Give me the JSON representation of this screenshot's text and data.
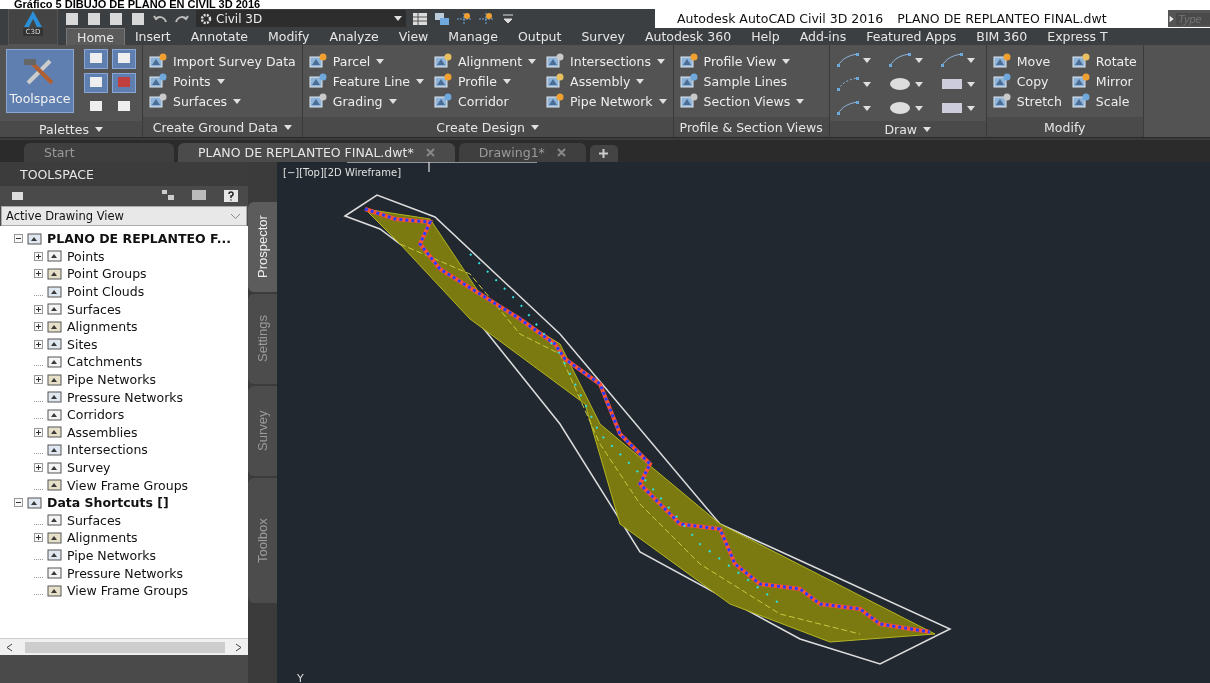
{
  "caption": "Gráfico 5 DIBUJO DE PLANO EN CIVIL 3D 2016",
  "title_bar": {
    "app_badge": "C3D",
    "workspace": "Civil 3D",
    "title": "Autodesk AutoCAD Civil 3D 2016",
    "document": "PLANO DE REPLANTEO FINAL.dwt",
    "search": {
      "placeholder": "Type"
    }
  },
  "ribbon_tabs": [
    {
      "label": "Home",
      "selected": true
    },
    {
      "label": "Insert",
      "selected": false
    },
    {
      "label": "Annotate",
      "selected": false
    },
    {
      "label": "Modify",
      "selected": false
    },
    {
      "label": "Analyze",
      "selected": false
    },
    {
      "label": "View",
      "selected": false
    },
    {
      "label": "Manage",
      "selected": false
    },
    {
      "label": "Output",
      "selected": false
    },
    {
      "label": "Survey",
      "selected": false
    },
    {
      "label": "Autodesk 360",
      "selected": false
    },
    {
      "label": "Help",
      "selected": false
    },
    {
      "label": "Add-ins",
      "selected": false
    },
    {
      "label": "Featured Apps",
      "selected": false
    },
    {
      "label": "BIM 360",
      "selected": false
    },
    {
      "label": "Express T",
      "selected": false
    }
  ],
  "ribbon_panels": [
    {
      "kind": "palettes",
      "title": "Palettes",
      "dropdown": true,
      "big_button": "Toolspace"
    },
    {
      "kind": "tools",
      "title": "Create Ground Data",
      "dropdown": true,
      "columns": [
        [
          {
            "label": "Import Survey Data",
            "dropdown": false
          },
          {
            "label": "Points",
            "dropdown": true
          },
          {
            "label": "Surfaces",
            "dropdown": true
          }
        ]
      ]
    },
    {
      "kind": "tools",
      "title": "Create Design",
      "dropdown": true,
      "columns": [
        [
          {
            "label": "Parcel",
            "dropdown": true
          },
          {
            "label": "Feature Line",
            "dropdown": true
          },
          {
            "label": "Grading",
            "dropdown": true
          }
        ],
        [
          {
            "label": "Alignment",
            "dropdown": true
          },
          {
            "label": "Profile",
            "dropdown": true
          },
          {
            "label": "Corridor",
            "dropdown": false
          }
        ],
        [
          {
            "label": "Intersections",
            "dropdown": true
          },
          {
            "label": "Assembly",
            "dropdown": true
          },
          {
            "label": "Pipe Network",
            "dropdown": true
          }
        ]
      ]
    },
    {
      "kind": "tools",
      "title": "Profile & Section Views",
      "dropdown": false,
      "columns": [
        [
          {
            "label": "Profile View",
            "dropdown": true
          },
          {
            "label": "Sample Lines",
            "dropdown": false
          },
          {
            "label": "Section Views",
            "dropdown": true
          }
        ]
      ]
    },
    {
      "kind": "draw",
      "title": "Draw",
      "dropdown": true
    },
    {
      "kind": "tools",
      "title": "Modify",
      "dropdown": false,
      "columns": [
        [
          {
            "label": "Move",
            "dropdown": false
          },
          {
            "label": "Copy",
            "dropdown": false
          },
          {
            "label": "Stretch",
            "dropdown": false
          }
        ],
        [
          {
            "label": "Rotate",
            "dropdown": false
          },
          {
            "label": "Mirror",
            "dropdown": false
          },
          {
            "label": "Scale",
            "dropdown": false
          }
        ]
      ]
    }
  ],
  "document_tabs": [
    {
      "label": "Start",
      "selected": false,
      "closable": false
    },
    {
      "label": "PLANO DE REPLANTEO FINAL.dwt*",
      "selected": true,
      "closable": true
    },
    {
      "label": "Drawing1*",
      "selected": false,
      "closable": true
    }
  ],
  "toolspace": {
    "title": "TOOLSPACE",
    "view": "Active Drawing View",
    "tree": [
      {
        "label": "PLANO DE REPLANTEO F...",
        "expandable": true,
        "expanded": true,
        "children": [
          {
            "label": "Points",
            "expandable": true,
            "expanded": false
          },
          {
            "label": "Point Groups",
            "expandable": true,
            "expanded": false
          },
          {
            "label": "Point Clouds",
            "expandable": false
          },
          {
            "label": "Surfaces",
            "expandable": true,
            "expanded": false
          },
          {
            "label": "Alignments",
            "expandable": true,
            "expanded": false
          },
          {
            "label": "Sites",
            "expandable": true,
            "expanded": false
          },
          {
            "label": "Catchments",
            "expandable": false
          },
          {
            "label": "Pipe Networks",
            "expandable": true,
            "expanded": false
          },
          {
            "label": "Pressure Networks",
            "expandable": false
          },
          {
            "label": "Corridors",
            "expandable": false
          },
          {
            "label": "Assemblies",
            "expandable": true,
            "expanded": false
          },
          {
            "label": "Intersections",
            "expandable": false
          },
          {
            "label": "Survey",
            "expandable": true,
            "expanded": false
          },
          {
            "label": "View Frame Groups",
            "expandable": false
          }
        ]
      },
      {
        "label": "Data Shortcuts []",
        "expandable": true,
        "expanded": true,
        "children": [
          {
            "label": "Surfaces",
            "expandable": false
          },
          {
            "label": "Alignments",
            "expandable": true,
            "expanded": false
          },
          {
            "label": "Pipe Networks",
            "expandable": false
          },
          {
            "label": "Pressure Networks",
            "expandable": false
          },
          {
            "label": "View Frame Groups",
            "expandable": false
          }
        ]
      }
    ],
    "side_tabs": [
      {
        "label": "Prospector",
        "selected": true
      },
      {
        "label": "Settings",
        "selected": false
      },
      {
        "label": "Survey",
        "selected": false
      },
      {
        "label": "Toolbox",
        "selected": false
      }
    ]
  },
  "viewport": {
    "label": "[−][Top][2D Wireframe]",
    "ucs_axis": "Y"
  }
}
